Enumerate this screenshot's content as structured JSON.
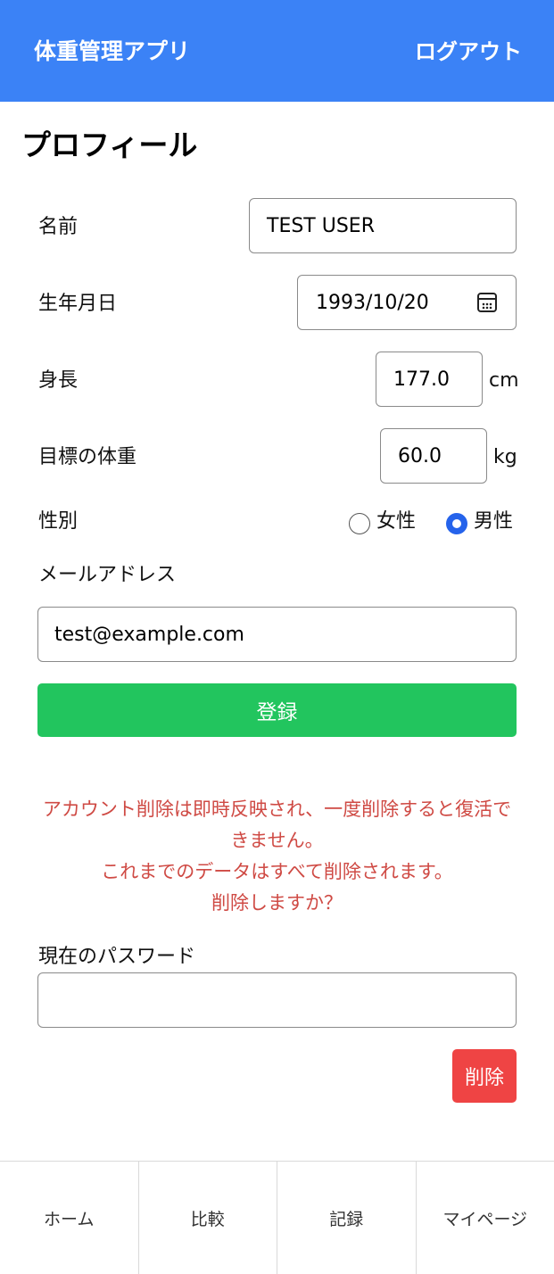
{
  "header": {
    "app_title": "体重管理アプリ",
    "logout_label": "ログアウト",
    "background_color": "#3b82f6"
  },
  "profile": {
    "title": "プロフィール",
    "name_label": "名前",
    "name_value": "TEST USER",
    "birthdate_label": "生年月日",
    "birthdate_value": "1993/10/20",
    "height_label": "身長",
    "height_value": "177.0",
    "height_unit": "cm",
    "target_weight_label": "目標の体重",
    "target_weight_value": "60.0",
    "target_weight_unit": "kg",
    "gender_label": "性別",
    "gender_options": [
      "女性",
      "男性"
    ],
    "gender_selected": "男性",
    "email_label": "メールアドレス",
    "email_value": "test@example.com",
    "register_label": "登録",
    "register_color": "#22c55e"
  },
  "delete_account": {
    "warning_lines": [
      "アカウント削除は即時反映され、一度削除すると復活で",
      "きません。",
      "これまでのデータはすべて削除されます。",
      "削除しますか？"
    ],
    "warning_color": "#cf4a44",
    "password_label": "現在のパスワード",
    "password_value": "",
    "delete_label": "削除",
    "delete_color": "#ef4444"
  },
  "bottom_nav": {
    "items": [
      "ホーム",
      "比較",
      "記録",
      "マイページ"
    ]
  },
  "icons": {
    "calendar": "calendar-icon",
    "radio_unchecked": "radio-unchecked-icon",
    "radio_checked": "radio-checked-icon"
  }
}
